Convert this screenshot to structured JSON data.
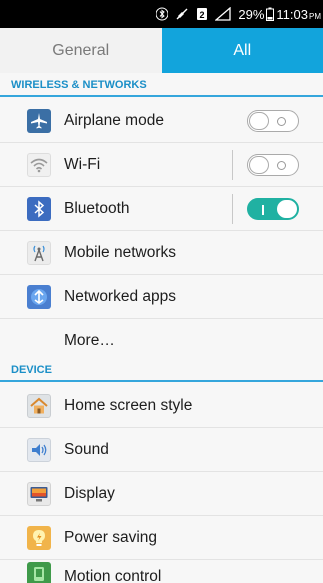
{
  "status_bar": {
    "battery_percent": "29%",
    "time": "11:03",
    "ampm": "PM"
  },
  "tabs": [
    {
      "label": "General",
      "selected": false
    },
    {
      "label": "All",
      "selected": true
    }
  ],
  "sections": {
    "wireless": "WIRELESS & NETWORKS",
    "device": "DEVICE"
  },
  "items": {
    "airplane": {
      "label": "Airplane mode",
      "icon": "airplane-icon",
      "toggle": "off"
    },
    "wifi": {
      "label": "Wi-Fi",
      "icon": "wifi-icon",
      "toggle": "off"
    },
    "bluetooth": {
      "label": "Bluetooth",
      "icon": "bluetooth-icon",
      "toggle": "on"
    },
    "mobile": {
      "label": "Mobile networks",
      "icon": "antenna-icon"
    },
    "networked_apps": {
      "label": "Networked apps",
      "icon": "apps-network-icon"
    },
    "more": {
      "label": "More…"
    },
    "home_style": {
      "label": "Home screen style",
      "icon": "home-icon"
    },
    "sound": {
      "label": "Sound",
      "icon": "speaker-icon"
    },
    "display": {
      "label": "Display",
      "icon": "display-icon"
    },
    "power": {
      "label": "Power saving",
      "icon": "lightbulb-icon"
    },
    "motion": {
      "label": "Motion control",
      "icon": "motion-icon"
    }
  },
  "colors": {
    "accent": "#12a4dc",
    "section_text": "#1b8fc7",
    "toggle_on": "#20b1a2"
  }
}
